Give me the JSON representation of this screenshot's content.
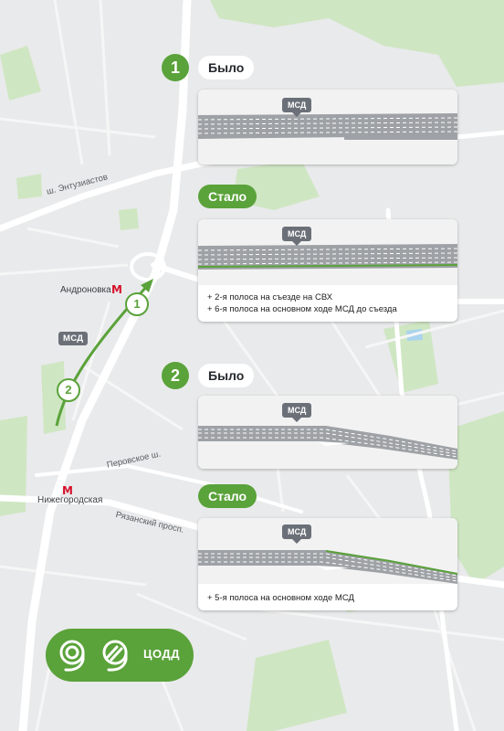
{
  "map": {
    "streets": {
      "entuziastov": "ш. Энтузиастов",
      "perovskoe": "Перовское ш.",
      "ryazansky": "Рязанский просп."
    },
    "metro": [
      {
        "name": "Андроновка",
        "symbol": "М"
      },
      {
        "name": "Нижегородская",
        "symbol": "М"
      }
    ],
    "msd_label": "МСД",
    "markers": [
      "1",
      "2"
    ],
    "colors": {
      "green": "#5aa23a",
      "park": "#cfe6c3",
      "road": "#ffffff",
      "background": "#e9eaeb"
    }
  },
  "sections": [
    {
      "number": "1",
      "before_label": "Было",
      "after_label": "Стало",
      "before_tag": "МСД",
      "after_tag": "МСД",
      "notes": [
        "+ 2-я полоса на съезде на СВХ",
        "+ 6-я полоса на основном ходе МСД до съезда"
      ]
    },
    {
      "number": "2",
      "before_label": "Было",
      "after_label": "Стало",
      "before_tag": "МСД",
      "after_tag": "МСД",
      "notes": [
        "+ 5-я полоса на основном ходе МСД"
      ]
    }
  ],
  "logo": {
    "text": "ЦОДД"
  }
}
